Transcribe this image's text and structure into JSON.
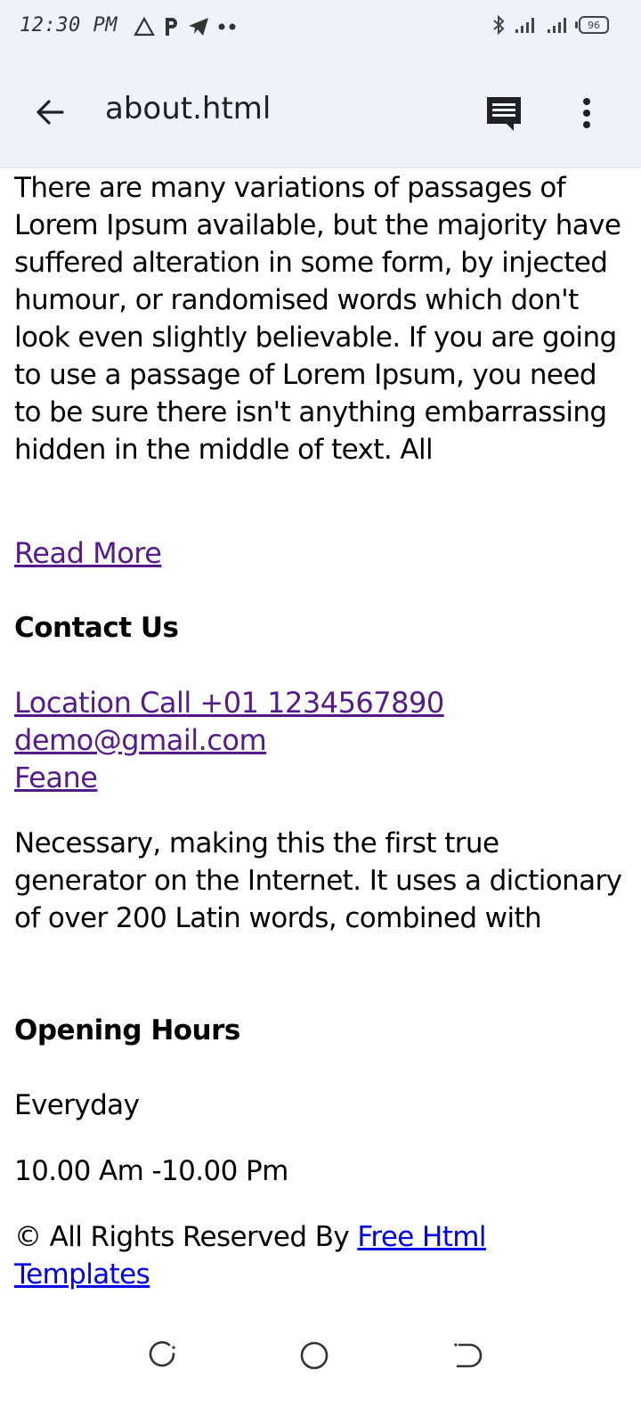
{
  "status_bar": {
    "time": "12:30 PM",
    "battery": "96"
  },
  "app_bar": {
    "title": "about.html",
    "icons": [
      "back-arrow-icon",
      "comment-icon",
      "more-vert-icon"
    ]
  },
  "content": {
    "intro_paragraph": "There are many variations of passages of Lorem Ipsum available, but the majority have suffered alteration in some form, by injected humour, or randomised words which don't look even slightly believable. If you are going to use a passage of Lorem Ipsum, you need to be sure there isn't anything embarrassing hidden in the middle of text. All",
    "read_more": "Read More",
    "contact_heading": "Contact Us",
    "contact_links": {
      "location_call": "Location Call +01 1234567890",
      "email": "demo@gmail.com",
      "feane": "Feane"
    },
    "second_paragraph": "Necessary, making this the first true generator on the Internet. It uses a dictionary of over 200 Latin words, combined with",
    "hours_heading": "Opening Hours",
    "everyday": "Everyday",
    "hours": "10.00 Am -10.00 Pm",
    "copyright_prefix": "© All Rights Reserved By ",
    "copyright_link": "Free Html Templates"
  },
  "colors": {
    "visited_link": "#551a8b",
    "link": "#0000ee",
    "app_bar_bg": "#eef2fb"
  },
  "nav_bar": {
    "icons": [
      "recents-icon",
      "home-icon",
      "back-icon"
    ]
  }
}
